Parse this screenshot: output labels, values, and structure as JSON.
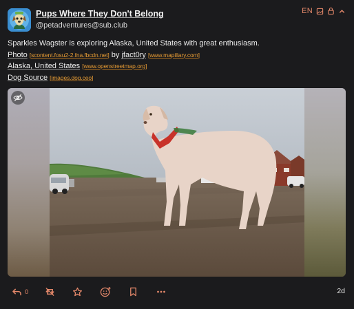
{
  "author": {
    "display_name": "Pups Where They Don't Belong",
    "handle": "@petadventures@sub.club"
  },
  "meta": {
    "language": "EN",
    "icons": [
      "image-icon",
      "lock-icon",
      "chevron-up-icon"
    ]
  },
  "content": {
    "text": "Sparkles Wagster is exploring Alaska, United States with great enthusiasm.",
    "photo_label": "Photo",
    "photo_source": "[scontent.fosu2-2.fna.fbcdn.net]",
    "photo_by": "by",
    "photo_author": "jfact0ry",
    "photo_author_source": "[www.mapillary.com]",
    "location_label": "Alaska, United States",
    "location_source": "[www.openstreetmap.org]",
    "dog_label": "Dog Source",
    "dog_source": "[images.dog.ceo]"
  },
  "actions": {
    "reply_count": "0",
    "icons": [
      "reply-icon",
      "boost-icon",
      "favourite-icon",
      "react-icon",
      "bookmark-icon",
      "more-icon"
    ]
  },
  "timestamp": "2d",
  "colors": {
    "accent": "#e4886a",
    "link_source": "#e69b34",
    "background": "#1b1b1d"
  }
}
